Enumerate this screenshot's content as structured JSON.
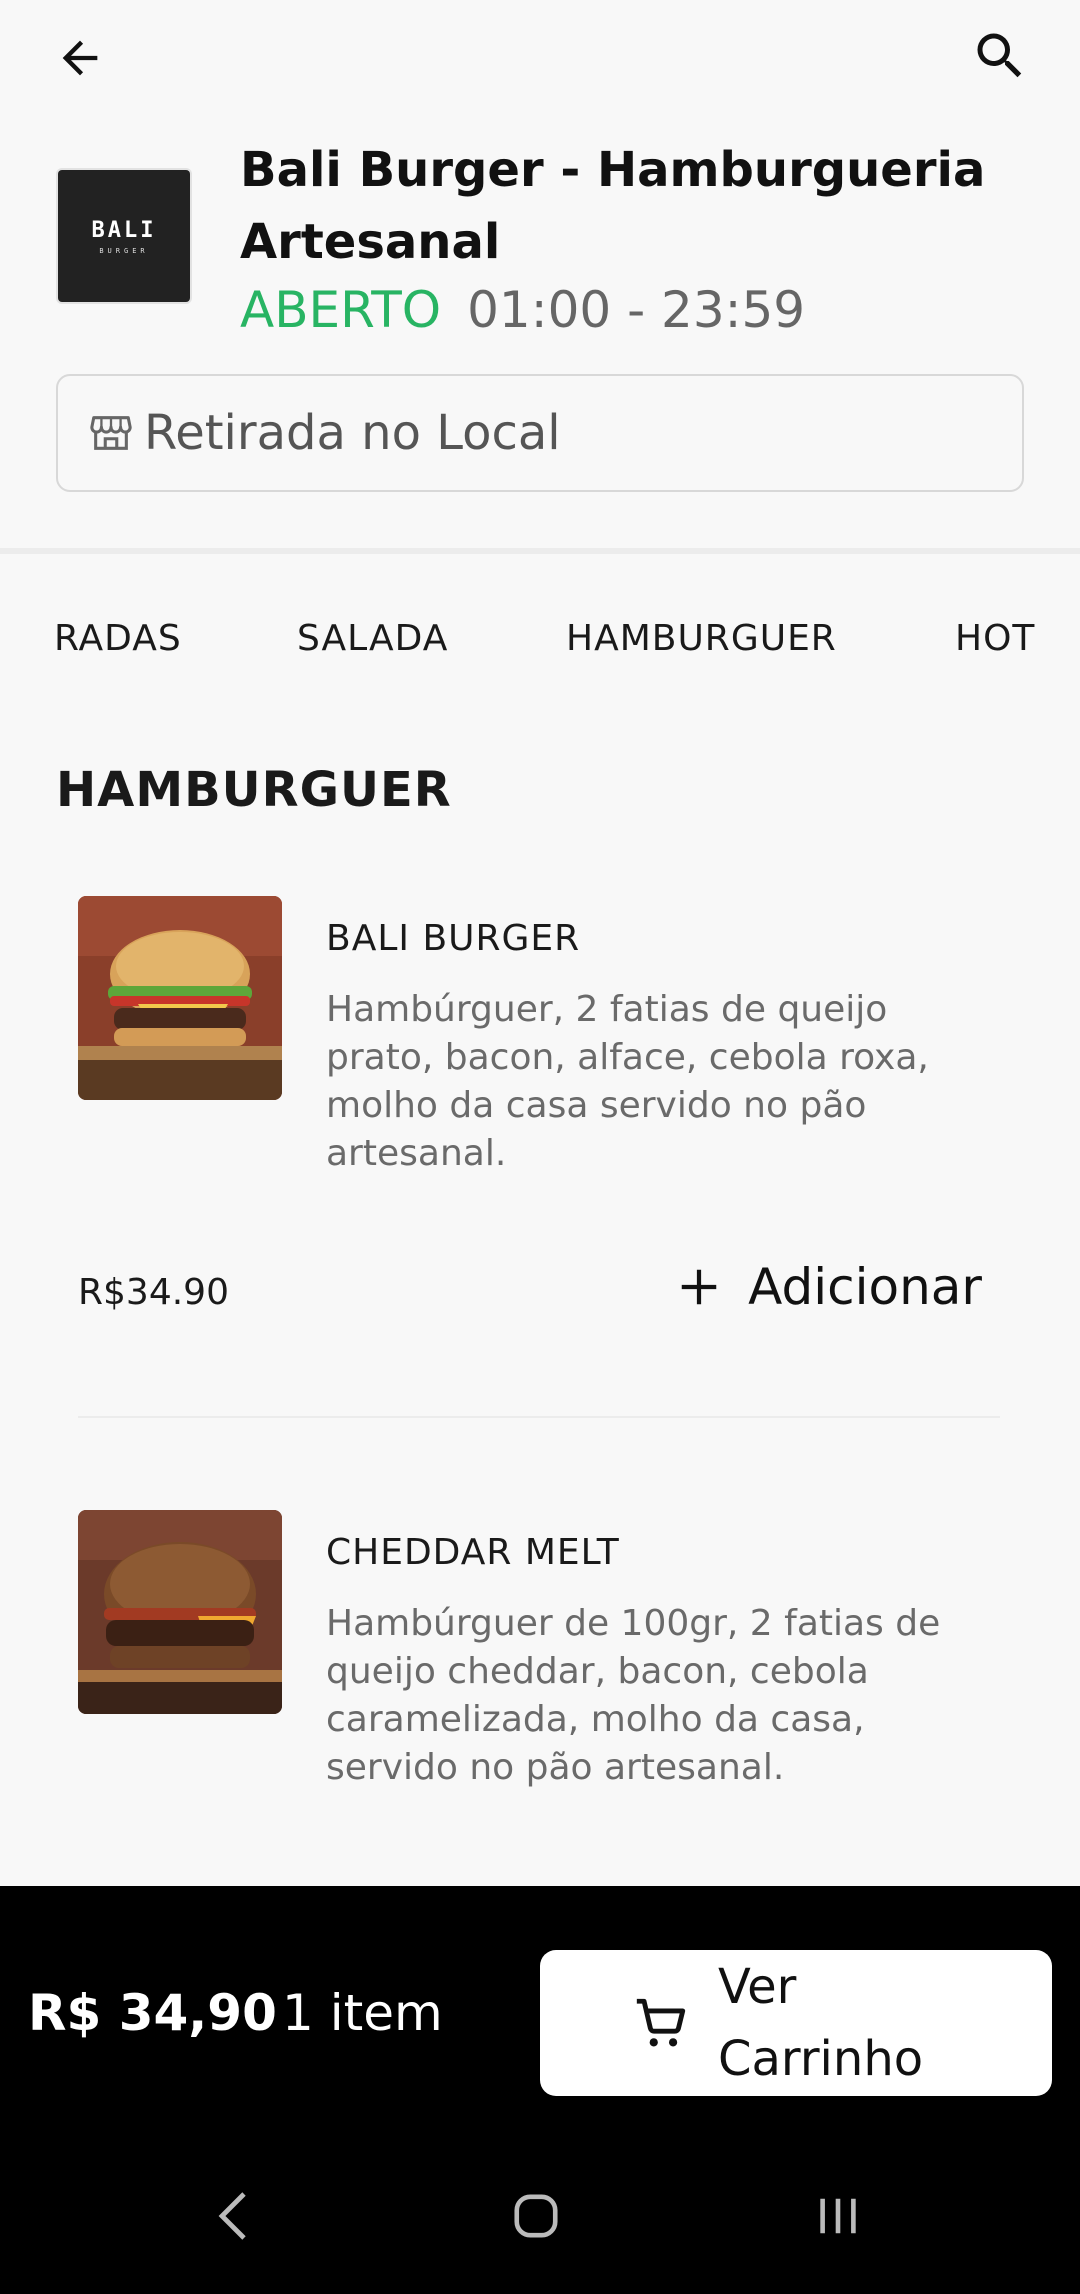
{
  "header": {
    "back_icon": "arrow-left-icon",
    "search_icon": "search-icon"
  },
  "store": {
    "logo_text": "BALI",
    "logo_subtext": "BURGER",
    "name": "Bali Burger - Hamburgueria Artesanal",
    "status": "ABERTO",
    "hours": "01:00 - 23:59",
    "status_color": "#28b463"
  },
  "pickup": {
    "icon": "storefront-icon",
    "label": "Retirada no Local"
  },
  "tabs": [
    "RADAS",
    "SALADA",
    "HAMBURGUER",
    "HOT"
  ],
  "section": {
    "title": "HAMBURGUER"
  },
  "items": [
    {
      "name": "BALI BURGER",
      "description": "Hambúrguer, 2 fatias de queijo prato, bacon, alface, cebola roxa, molho da casa servido no pão artesanal.",
      "price": "R$34.90",
      "add_label": "Adicionar"
    },
    {
      "name": "CHEDDAR MELT",
      "description": "Hambúrguer de 100gr, 2 fatias de queijo cheddar, bacon, cebola caramelizada, molho da casa, servido no pão artesanal."
    }
  ],
  "cart": {
    "total": "R$ 34,90",
    "count": "1 item",
    "button_label": "Ver Carrinho",
    "button_icon": "cart-icon"
  },
  "system_nav": {
    "back": "nav-back-icon",
    "home": "nav-home-icon",
    "recents": "nav-recents-icon"
  }
}
